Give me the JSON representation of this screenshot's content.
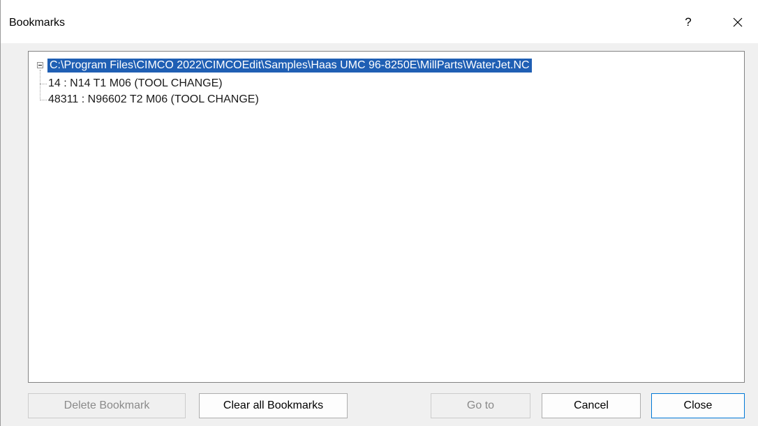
{
  "window": {
    "title": "Bookmarks",
    "help_label": "?"
  },
  "tree": {
    "root": {
      "label": "C:\\Program Files\\CIMCO 2022\\CIMCOEdit\\Samples\\Haas UMC 96-8250E\\MillParts\\WaterJet.NC",
      "expanded": true,
      "selected": true
    },
    "children": [
      {
        "label": "14 : N14 T1 M06 (TOOL CHANGE)"
      },
      {
        "label": "48311 : N96602 T2 M06 (TOOL CHANGE)"
      }
    ]
  },
  "buttons": {
    "delete_bookmark": "Delete Bookmark",
    "clear_all_bookmarks": "Clear all Bookmarks",
    "go_to": "Go to",
    "cancel": "Cancel",
    "close": "Close"
  },
  "colors": {
    "selection": "#1f5fb4",
    "default_button_border": "#0078d7"
  }
}
